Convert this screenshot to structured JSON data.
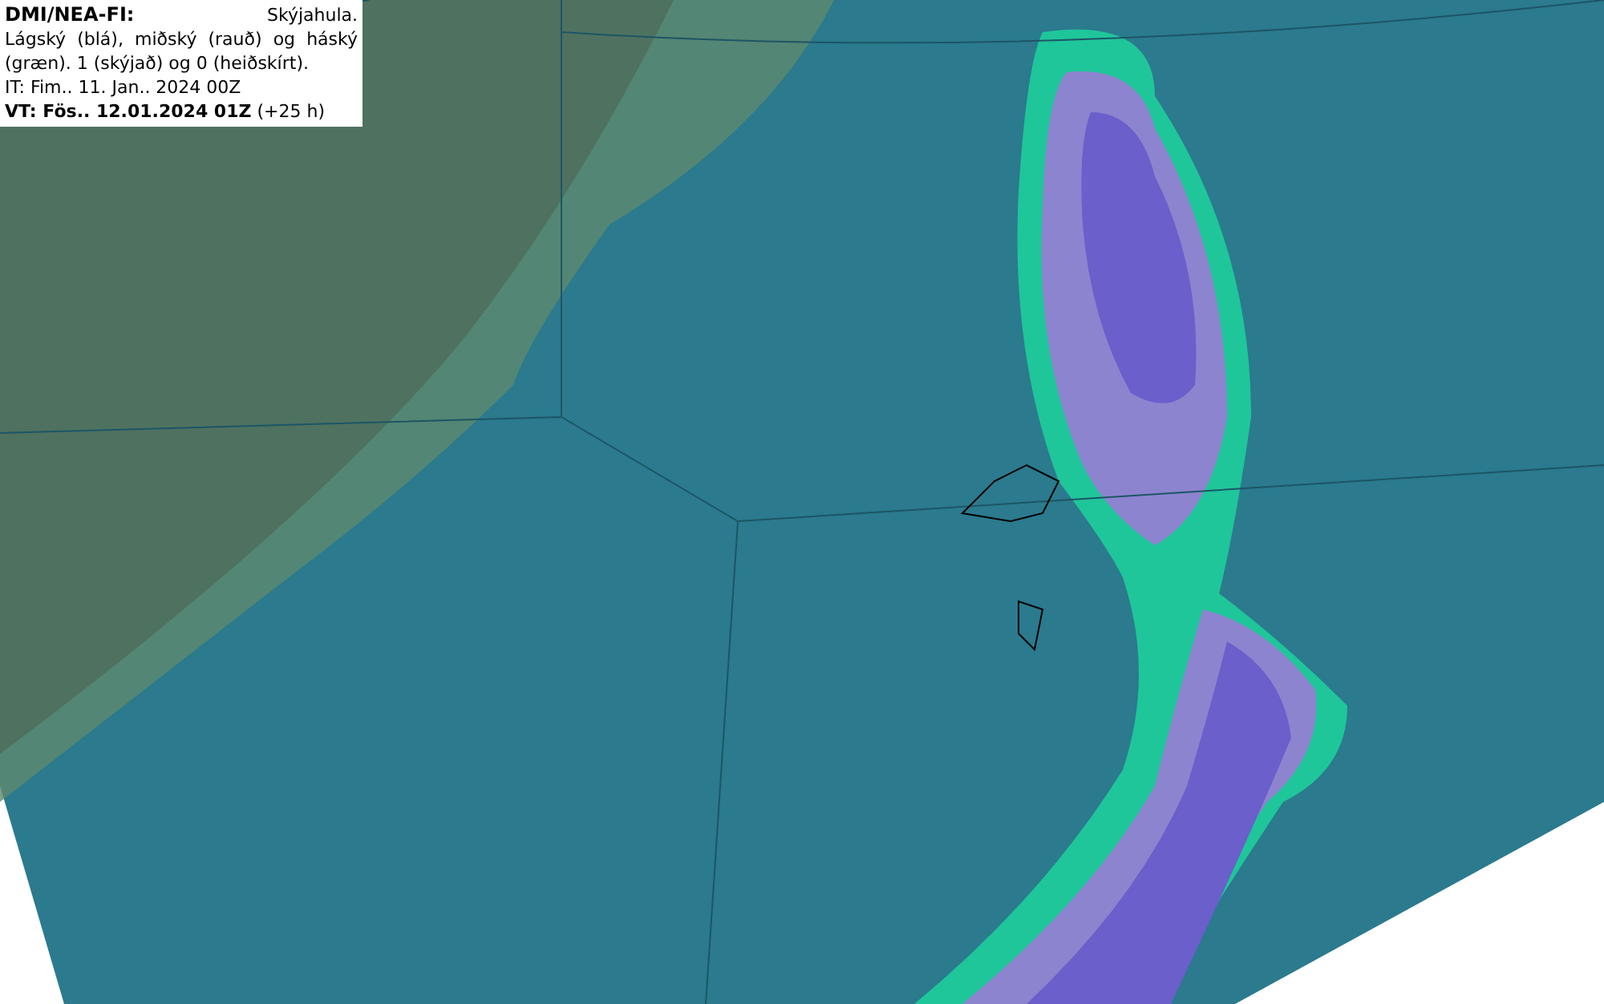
{
  "legend": {
    "source": "DMI/NEA-FI:",
    "title": "Skýjahula.",
    "description": "Lágský (blá), miðský (rauð) og háský (græn). 1 (skýjað) og 0 (heiðskírt).",
    "issue_time": "IT: Fim.. 11. Jan.. 2024 00Z",
    "valid_time": "**VT: Fös.. 12.01.2024 01Z** (+25 h)"
  }
}
